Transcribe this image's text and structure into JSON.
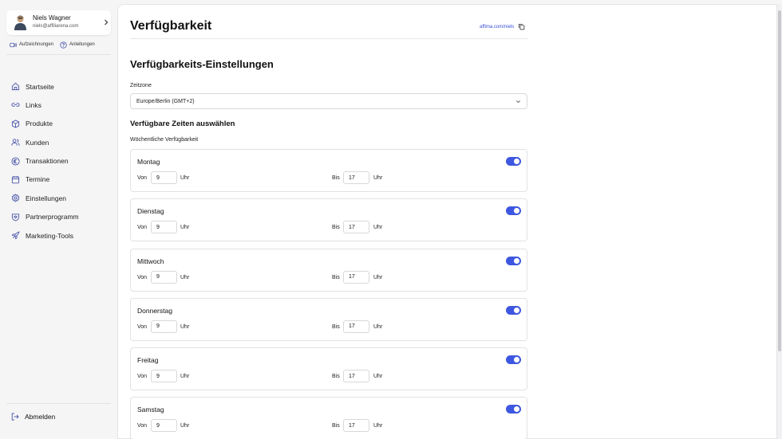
{
  "user": {
    "name": "Niels Wagner",
    "email": "niels@affiliarena.com"
  },
  "quick_links": {
    "recordings": "Aufzeichnungen",
    "guides": "Anleitungen"
  },
  "nav": {
    "items": [
      {
        "label": "Startseite",
        "icon": "home-icon"
      },
      {
        "label": "Links",
        "icon": "link-icon"
      },
      {
        "label": "Produkte",
        "icon": "package-icon"
      },
      {
        "label": "Kunden",
        "icon": "users-icon"
      },
      {
        "label": "Transaktionen",
        "icon": "euro-icon"
      },
      {
        "label": "Termine",
        "icon": "calendar-icon"
      },
      {
        "label": "Einstellungen",
        "icon": "gear-icon"
      },
      {
        "label": "Partnerprogramm",
        "icon": "partner-icon"
      },
      {
        "label": "Marketing-Tools",
        "icon": "rocket-icon"
      }
    ],
    "logout": "Abmelden"
  },
  "page": {
    "title": "Verfügbarkeit",
    "link": "affima.com/niels",
    "section_title": "Verfügbarkeits-Einstellungen",
    "timezone_label": "Zeitzone",
    "timezone_value": "Europe/Berlin (GMT+2)",
    "times_title": "Verfügbare Zeiten auswählen",
    "weekly_label": "Wöchentliche Verfügbarkeit"
  },
  "labels": {
    "from": "Von",
    "to": "Bis",
    "unit": "Uhr"
  },
  "days": [
    {
      "name": "Montag",
      "from": "9",
      "to": "17",
      "enabled": true
    },
    {
      "name": "Dienstag",
      "from": "9",
      "to": "17",
      "enabled": true
    },
    {
      "name": "Mittwoch",
      "from": "9",
      "to": "17",
      "enabled": true
    },
    {
      "name": "Donnerstag",
      "from": "9",
      "to": "17",
      "enabled": true
    },
    {
      "name": "Freitag",
      "from": "9",
      "to": "17",
      "enabled": true
    },
    {
      "name": "Samstag",
      "from": "9",
      "to": "17",
      "enabled": true
    }
  ],
  "colors": {
    "accent": "#3e57e0",
    "link": "#3b4fd6",
    "icon": "#4b57a8"
  }
}
